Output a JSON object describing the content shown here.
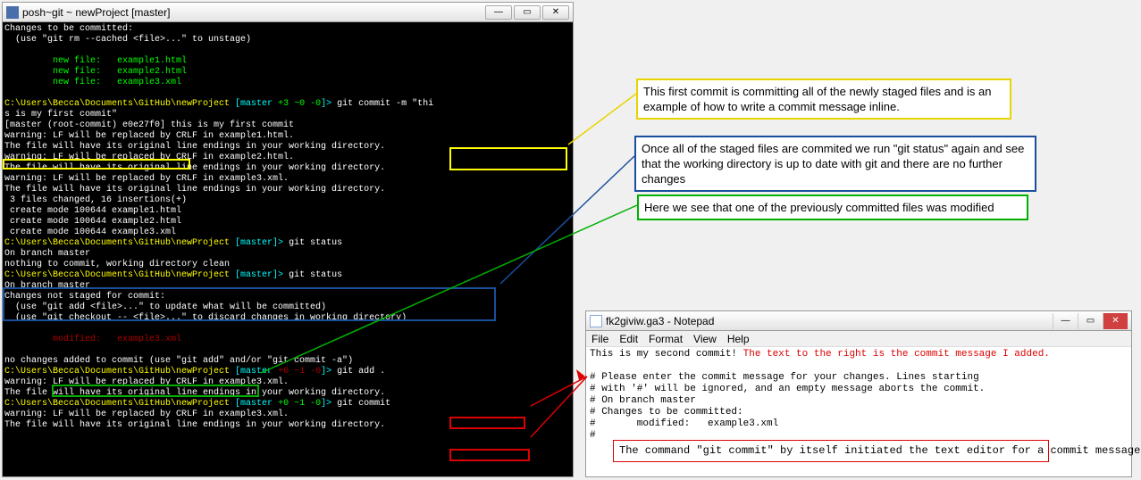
{
  "terminal": {
    "title": "posh~git ~ newProject [master]",
    "lines": {
      "l1": "Changes to be committed:",
      "l2": "  (use \"git rm --cached <file>...\" to unstage)",
      "l3": "         new file:   example1.html",
      "l4": "         new file:   example2.html",
      "l5": "         new file:   example3.xml",
      "promptPath": "C:\\Users\\Becca\\Documents\\GitHub\\newProject",
      "branch1": " [master",
      "branchStats": " +3 ~0 -0",
      "branchEnd": "]> ",
      "cmd1a": "git commit -m \"thi",
      "cmd1b": "s is my first commit\"",
      "r1": "[master (root-commit) e0e27f0] this is my first commit",
      "r2": "warning: LF will be replaced by CRLF in example1.html.",
      "r3": "The file will have its original line endings in your working directory.",
      "r4": "warning: LF will be replaced by CRLF in example2.html.",
      "r5": "The file will have its original line endings in your working directory.",
      "r6": "warning: LF will be replaced by CRLF in example3.xml.",
      "r7": "The file will have its original line endings in your working directory.",
      "r8": " 3 files changed, 16 insertions(+)",
      "r9": " create mode 100644 example1.html",
      "r10": " create mode 100644 example2.html",
      "r11": " create mode 100644 example3.xml",
      "branch2": " [master]> ",
      "cmd2": "git status",
      "s1": "On branch master",
      "s2": "nothing to commit, working directory clean",
      "cmd3": "git status",
      "s3": "On branch master",
      "s4": "Changes not staged for commit:",
      "s5": "  (use \"git add <file>...\" to update what will be committed)",
      "s6": "  (use \"git checkout -- <file>...\" to discard changes in working directory)",
      "s7": "         modified:   example3.xml",
      "s8": "no changes added to commit (use \"git add\" and/or \"git commit -a\")",
      "branch3stats": " +0 ~1 -0",
      "cmd4": "git add .",
      "r12": "warning: LF will be replaced by CRLF in example3.xml.",
      "r13": "The file will have its original line endings in your working directory.",
      "branch4stats": " +0 ~1 -0",
      "cmd5": "git commit",
      "r14": "warning: LF will be replaced by CRLF in example3.xml.",
      "r15": "The file will have its original line endings in your working directory."
    }
  },
  "notepad": {
    "title": "fk2giviw.ga3 - Notepad",
    "menus": {
      "file": "File",
      "edit": "Edit",
      "format": "Format",
      "view": "View",
      "help": "Help"
    },
    "content": {
      "l1": "This is my second commit!",
      "ann1": "The text to the right is the commit message I added.",
      "l2": "",
      "l3": "# Please enter the commit message for your changes. Lines starting",
      "l4": "# with '#' will be ignored, and an empty message aborts the commit.",
      "l5": "# On branch master",
      "l6": "# Changes to be committed:",
      "l7": "#       modified:   example3.xml",
      "l8": "#"
    }
  },
  "annotations": {
    "a1": "This first commit is committing all of the newly staged files and is an example of how to write a commit message inline.",
    "a2": "Once all of the staged files are commited we run \"git status\" again and see that the working directory is up to date with git and there are no further changes",
    "a3": "Here we see that one of the previously committed files was modified",
    "a4": "The command \"git commit\" by itself initiated the text editor for a commit message to be added. Once the message is added, go to file, then save, and close the text editor window for the commit to be done."
  }
}
